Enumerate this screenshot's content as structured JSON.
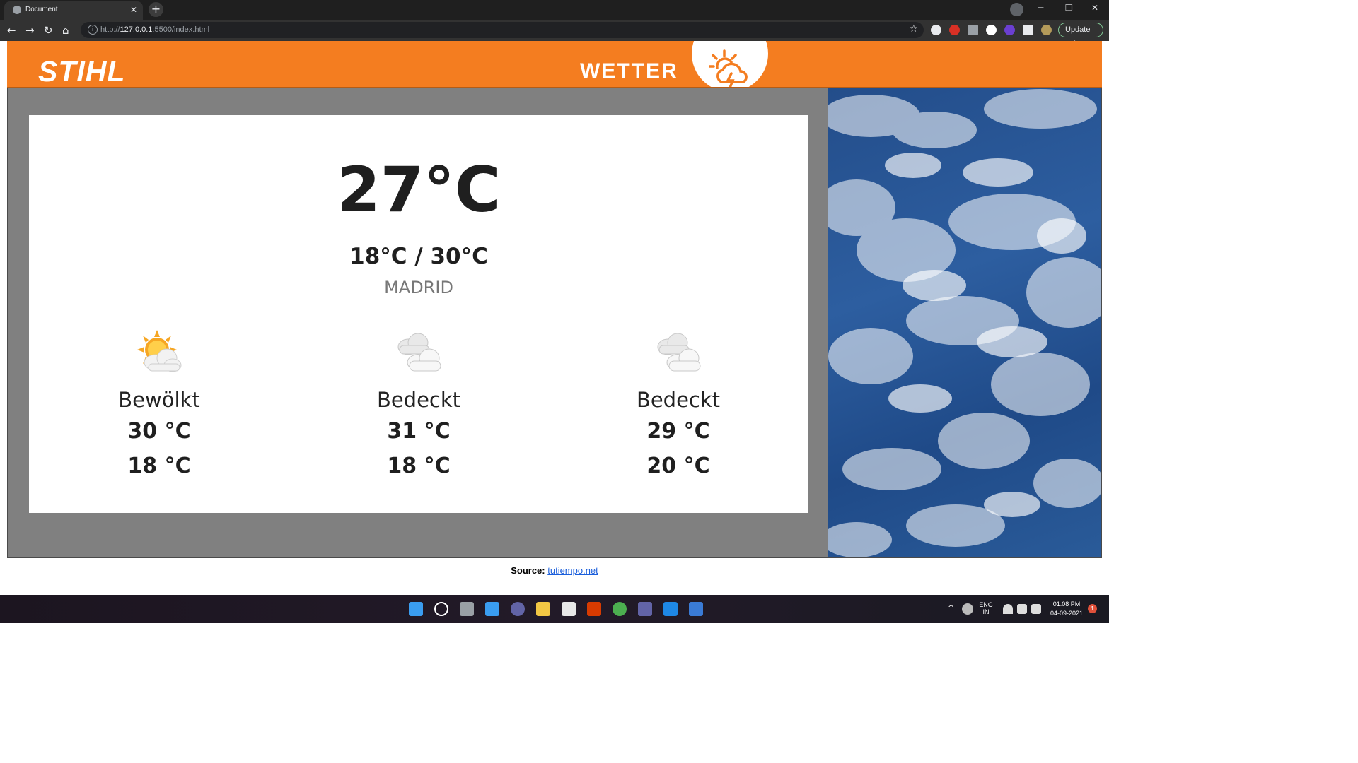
{
  "browser": {
    "tab_title": "Document",
    "tab_close": "✕",
    "new_tab": "+",
    "url_prefix": "http://",
    "url_host": "127.0.0.1",
    "url_rest": ":5500/index.html",
    "update_label": "Update",
    "update_menu": "⋮"
  },
  "header": {
    "logo_text": "STIHL",
    "wetter_label": "WETTER",
    "brand_color": "#f47d20"
  },
  "current": {
    "temperature": "27°C",
    "range": "18°C / 30°C",
    "city": "MADRID"
  },
  "forecast": [
    {
      "icon": "partly-cloudy-sun-icon",
      "condition": "Bewölkt",
      "high": "30 °C",
      "low": "18 °C"
    },
    {
      "icon": "overcast-clouds-icon",
      "condition": "Bedeckt",
      "high": "31 °C",
      "low": "18 °C"
    },
    {
      "icon": "overcast-clouds-icon",
      "condition": "Bedeckt",
      "high": "29 °C",
      "low": "20 °C"
    }
  ],
  "footer": {
    "source_label": "Source:",
    "source_link": "tutiempo.net"
  },
  "taskbar": {
    "lang_top": "ENG",
    "lang_bottom": "IN",
    "time": "01:08 PM",
    "date": "04-09-2021",
    "notification_count": "1"
  }
}
